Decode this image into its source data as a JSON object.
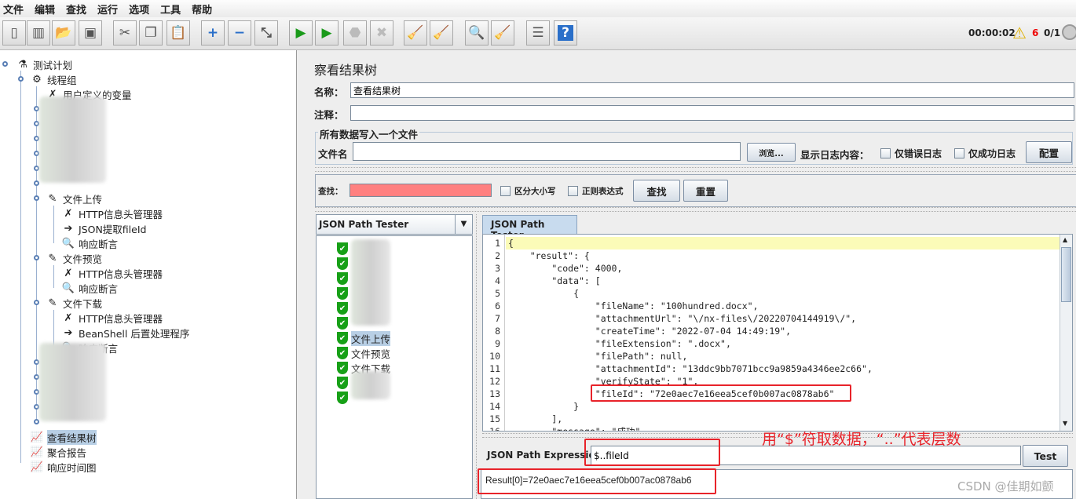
{
  "menu": [
    "文件",
    "编辑",
    "查找",
    "运行",
    "选项",
    "工具",
    "帮助"
  ],
  "toolbar": {
    "buttons": [
      "new-icon",
      "templates-icon",
      "open-icon",
      "save-icon",
      "cut-icon",
      "copy-icon",
      "paste-icon",
      "expand-icon",
      "collapse-icon",
      "toggle-icon",
      "start-icon",
      "start-no-pause-icon",
      "stop-icon",
      "shutdown-icon",
      "clear-icon",
      "clear-all-icon",
      "search-icon",
      "reset-search-icon",
      "function-helper-icon",
      "help-icon"
    ],
    "timer": "00:00:02",
    "warnings": "6",
    "threads": "0/1"
  },
  "tree": {
    "plan": "测试计划",
    "group": "线程组",
    "vars": "用户定义的变量",
    "upload": "文件上传",
    "upload_children": [
      "HTTP信息头管理器",
      "JSON提取fileId",
      "响应断言"
    ],
    "preview": "文件预览",
    "preview_children": [
      "HTTP信息头管理器",
      "响应断言"
    ],
    "download": "文件下载",
    "download_children": [
      "HTTP信息头管理器",
      "BeanShell 后置处理程序",
      "响应断言"
    ],
    "listeners": [
      "查看结果树",
      "聚合报告",
      "响应时间图"
    ]
  },
  "panel": {
    "title": "察看结果树",
    "name_label": "名称：",
    "name_value": "查看结果树",
    "comment_label": "注释：",
    "comment_value": "",
    "fieldset": "所有数据写入一个文件",
    "filename_label": "文件名",
    "filename_value": "",
    "browse": "浏览...",
    "log_label": "显示日志内容：",
    "errors_only": "仅错误日志",
    "success_only": "仅成功日志",
    "configure": "配置"
  },
  "search": {
    "label": "查找：",
    "value": "",
    "case": "区分大小写",
    "regex": "正则表达式",
    "find": "查找",
    "reset": "重置"
  },
  "results": {
    "renderer": "JSON Path Tester",
    "items": [
      "文件上传",
      "文件预览",
      "文件下载"
    ]
  },
  "tester": {
    "tab": "JSON Path Tester",
    "lines": [
      "{",
      "    \"result\": {",
      "        \"code\": 4000,",
      "        \"data\": [",
      "            {",
      "                \"fileName\": \"100hundred.docx\",",
      "                \"attachmentUrl\": \"\\/nx-files\\/20220704144919\\/\",",
      "                \"createTime\": \"2022-07-04 14:49:19\",",
      "                \"fileExtension\": \".docx\",",
      "                \"filePath\": null,",
      "                \"attachmentId\": \"13ddc9bb7071bcc9a9859a4346ee2c66\",",
      "                \"verifyState\": \"1\",",
      "                \"fileId\": \"72e0aec7e16eea5cef0b007ac0878ab6\"",
      "            }",
      "        ],",
      "        \"message\": \"成功\""
    ],
    "expr_label": "JSON Path Expression",
    "expr_value": "$..fileId",
    "test": "Test",
    "result": "Result[0]=72e0aec7e16eea5cef0b007ac0878ab6"
  },
  "annotation": "用“$”符取数据，“..”代表层数",
  "watermark": "CSDN @佳期如颤",
  "colors": {
    "highlight_line": "#fbfbb8",
    "search_error": "#ff8080",
    "annotation": "#e8232a",
    "selection": "#b8cfe5"
  }
}
